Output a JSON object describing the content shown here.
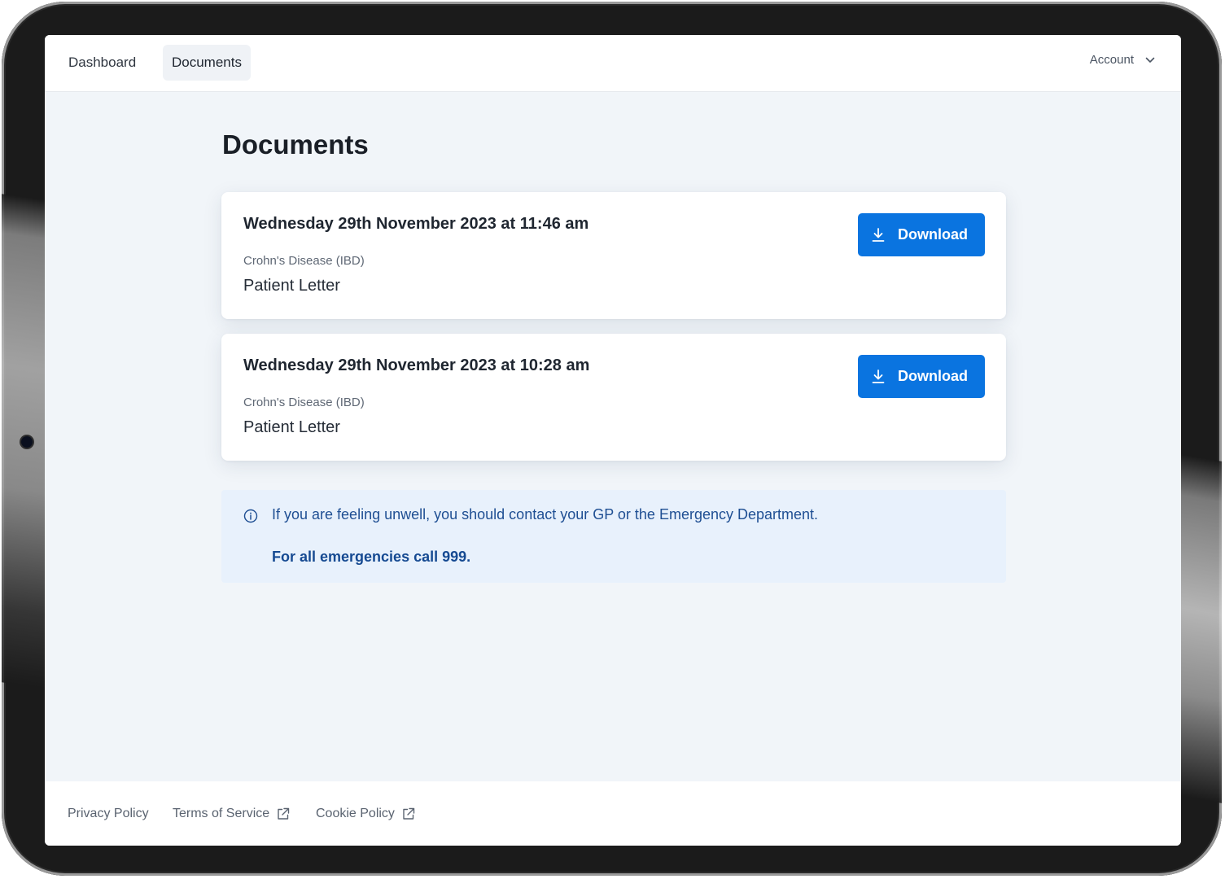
{
  "nav": {
    "items": [
      {
        "label": "Dashboard",
        "active": false
      },
      {
        "label": "Documents",
        "active": true
      }
    ],
    "account_label": "Account"
  },
  "page": {
    "title": "Documents"
  },
  "documents": [
    {
      "date": "Wednesday 29th November 2023 at 11:46 am",
      "category": "Crohn's Disease (IBD)",
      "type": "Patient Letter",
      "action_label": "Download"
    },
    {
      "date": "Wednesday 29th November 2023 at 10:28 am",
      "category": "Crohn's Disease (IBD)",
      "type": "Patient Letter",
      "action_label": "Download"
    }
  ],
  "notice": {
    "text": "If you are feeling unwell, you should contact your GP or the Emergency Department.",
    "emphasis": "For all emergencies call 999."
  },
  "footer": {
    "links": [
      {
        "label": "Privacy Policy",
        "external": false
      },
      {
        "label": "Terms of Service",
        "external": true
      },
      {
        "label": "Cookie Policy",
        "external": true
      }
    ]
  },
  "colors": {
    "primary": "#0a74e0",
    "background": "#f1f5f9",
    "notice_bg": "#e8f1fc",
    "notice_text": "#1f4f93",
    "device_bezel": "#1b1b1b"
  },
  "icons": {
    "account_chevron": "chevron-down-icon",
    "download": "download-icon",
    "notice": "info-icon",
    "external": "external-link-icon"
  }
}
